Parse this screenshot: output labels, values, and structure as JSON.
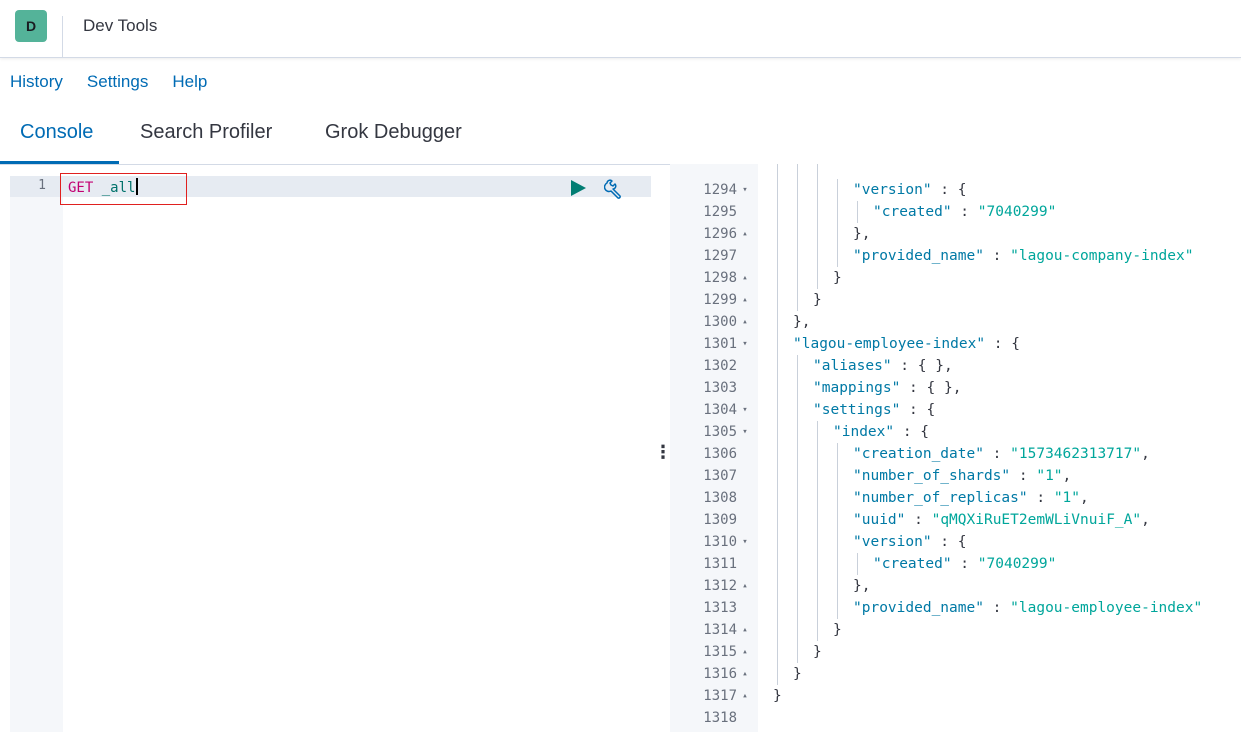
{
  "header": {
    "avatar_letter": "D",
    "avatar_color": "#54b399",
    "title": "Dev Tools"
  },
  "menu": [
    "History",
    "Settings",
    "Help"
  ],
  "tabs": [
    "Console",
    "Search Profiler",
    "Grok Debugger"
  ],
  "active_tab": "Console",
  "editor": {
    "line_number": "1",
    "method": "GET",
    "path": "_all",
    "run_icon": "play-icon",
    "settings_icon": "wrench-icon"
  },
  "output": {
    "lines": [
      {
        "num": "1294",
        "fold": "▾",
        "indent": 3,
        "tokens": [
          [
            "k",
            "\"version\""
          ],
          [
            "p",
            " : {"
          ]
        ]
      },
      {
        "num": "1295",
        "fold": "",
        "indent": 4,
        "tokens": [
          [
            "k",
            "\"created\""
          ],
          [
            "p",
            " : "
          ],
          [
            "s",
            "\"7040299\""
          ]
        ]
      },
      {
        "num": "1296",
        "fold": "▴",
        "indent": 3,
        "tokens": [
          [
            "p",
            "},"
          ]
        ]
      },
      {
        "num": "1297",
        "fold": "",
        "indent": 3,
        "tokens": [
          [
            "k",
            "\"provided_name\""
          ],
          [
            "p",
            " : "
          ],
          [
            "s",
            "\"lagou-company-index\""
          ]
        ]
      },
      {
        "num": "1298",
        "fold": "▴",
        "indent": 2,
        "tokens": [
          [
            "p",
            "}"
          ]
        ]
      },
      {
        "num": "1299",
        "fold": "▴",
        "indent": 1,
        "tokens": [
          [
            "p",
            "}"
          ]
        ]
      },
      {
        "num": "1300",
        "fold": "▴",
        "indent": 0,
        "tokens": [
          [
            "p",
            "},"
          ]
        ]
      },
      {
        "num": "1301",
        "fold": "▾",
        "indent": 0,
        "tokens": [
          [
            "k",
            "\"lagou-employee-index\""
          ],
          [
            "p",
            " : {"
          ]
        ]
      },
      {
        "num": "1302",
        "fold": "",
        "indent": 1,
        "tokens": [
          [
            "k",
            "\"aliases\""
          ],
          [
            "p",
            " : { },"
          ]
        ]
      },
      {
        "num": "1303",
        "fold": "",
        "indent": 1,
        "tokens": [
          [
            "k",
            "\"mappings\""
          ],
          [
            "p",
            " : { },"
          ]
        ]
      },
      {
        "num": "1304",
        "fold": "▾",
        "indent": 1,
        "tokens": [
          [
            "k",
            "\"settings\""
          ],
          [
            "p",
            " : {"
          ]
        ]
      },
      {
        "num": "1305",
        "fold": "▾",
        "indent": 2,
        "tokens": [
          [
            "k",
            "\"index\""
          ],
          [
            "p",
            " : {"
          ]
        ]
      },
      {
        "num": "1306",
        "fold": "",
        "indent": 3,
        "tokens": [
          [
            "k",
            "\"creation_date\""
          ],
          [
            "p",
            " : "
          ],
          [
            "s",
            "\"1573462313717\""
          ],
          [
            "p",
            ","
          ]
        ]
      },
      {
        "num": "1307",
        "fold": "",
        "indent": 3,
        "tokens": [
          [
            "k",
            "\"number_of_shards\""
          ],
          [
            "p",
            " : "
          ],
          [
            "s",
            "\"1\""
          ],
          [
            "p",
            ","
          ]
        ]
      },
      {
        "num": "1308",
        "fold": "",
        "indent": 3,
        "tokens": [
          [
            "k",
            "\"number_of_replicas\""
          ],
          [
            "p",
            " : "
          ],
          [
            "s",
            "\"1\""
          ],
          [
            "p",
            ","
          ]
        ]
      },
      {
        "num": "1309",
        "fold": "",
        "indent": 3,
        "tokens": [
          [
            "k",
            "\"uuid\""
          ],
          [
            "p",
            " : "
          ],
          [
            "s",
            "\"qMQXiRuET2emWLiVnuiF_A\""
          ],
          [
            "p",
            ","
          ]
        ]
      },
      {
        "num": "1310",
        "fold": "▾",
        "indent": 3,
        "tokens": [
          [
            "k",
            "\"version\""
          ],
          [
            "p",
            " : {"
          ]
        ]
      },
      {
        "num": "1311",
        "fold": "",
        "indent": 4,
        "tokens": [
          [
            "k",
            "\"created\""
          ],
          [
            "p",
            " : "
          ],
          [
            "s",
            "\"7040299\""
          ]
        ]
      },
      {
        "num": "1312",
        "fold": "▴",
        "indent": 3,
        "tokens": [
          [
            "p",
            "},"
          ]
        ]
      },
      {
        "num": "1313",
        "fold": "",
        "indent": 3,
        "tokens": [
          [
            "k",
            "\"provided_name\""
          ],
          [
            "p",
            " : "
          ],
          [
            "s",
            "\"lagou-employee-index\""
          ]
        ]
      },
      {
        "num": "1314",
        "fold": "▴",
        "indent": 2,
        "tokens": [
          [
            "p",
            "}"
          ]
        ]
      },
      {
        "num": "1315",
        "fold": "▴",
        "indent": 1,
        "tokens": [
          [
            "p",
            "}"
          ]
        ]
      },
      {
        "num": "1316",
        "fold": "▴",
        "indent": 0,
        "tokens": [
          [
            "p",
            "}"
          ]
        ]
      },
      {
        "num": "1317",
        "fold": "▴",
        "indent": -1,
        "tokens": [
          [
            "p",
            "}"
          ]
        ]
      },
      {
        "num": "1318",
        "fold": "",
        "indent": -1,
        "tokens": []
      }
    ]
  }
}
